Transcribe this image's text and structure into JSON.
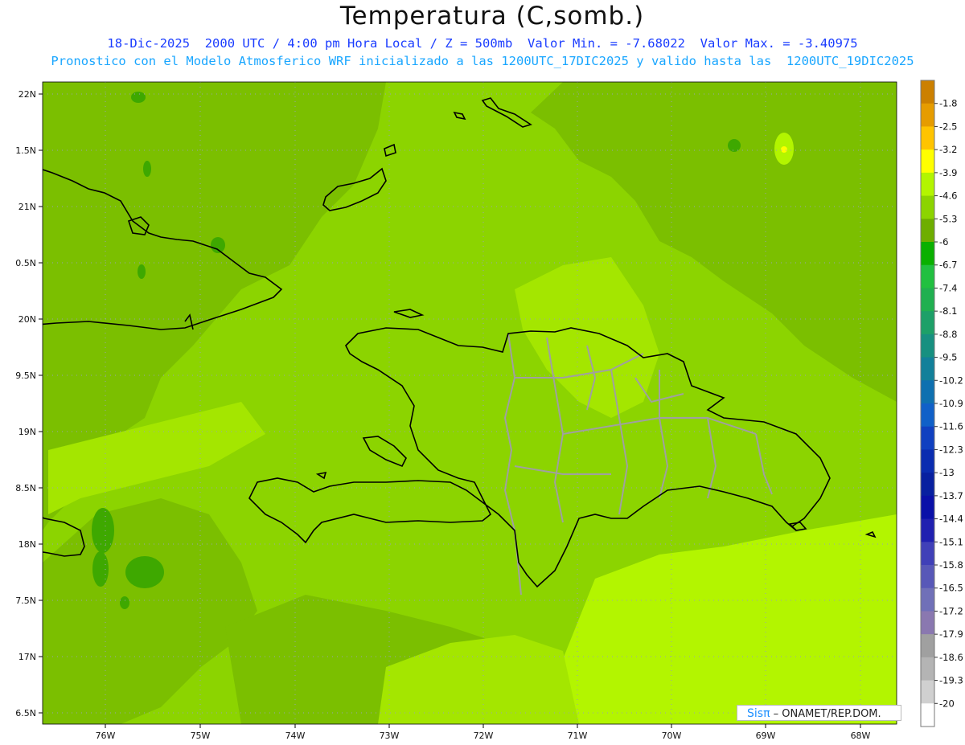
{
  "title": "Temperatura (C,somb.)",
  "subtitle_line1": "18-Dic-2025  2000 UTC / 4:00 pm Hora Local / Z = 500mb  Valor Min. = -7.68022  Valor Max. = -3.40975",
  "subtitle_line2": "Pronostico con el Modelo Atmosferico WRF inicializado a las 1200UTC_17DIC2025 y valido hasta las  1200UTC_19DIC2025",
  "map": {
    "lat_ticks": [
      "22N",
      "1.5N",
      "21N",
      "0.5N",
      "20N",
      "9.5N",
      "19N",
      "8.5N",
      "18N",
      "7.5N",
      "17N",
      "6.5N"
    ],
    "lon_ticks": [
      "76W",
      "75W",
      "74W",
      "73W",
      "72W",
      "71W",
      "70W",
      "69W",
      "68W"
    ],
    "background_color": "#8cd400",
    "colors": {
      "darker_green": "#7bbf00",
      "medium_green": "#8cd400",
      "light_green": "#a4e600",
      "lighter_green": "#b3f500",
      "dark_patch": "#3ea800",
      "yellow_spot": "#ffff00",
      "coastline": "#000000",
      "province_borders": "#a0a0a0",
      "grid": "#9aa0b0"
    }
  },
  "colorbar": {
    "labels": [
      "-1.8",
      "-2.5",
      "-3.2",
      "-3.9",
      "-4.6",
      "-5.3",
      "-6",
      "-6.7",
      "-7.4",
      "-8.1",
      "-8.8",
      "-9.5",
      "-10.2",
      "-10.9",
      "-11.6",
      "-12.3",
      "-13",
      "-13.7",
      "-14.4",
      "-15.1",
      "-15.8",
      "-16.5",
      "-17.2",
      "-17.9",
      "-18.6",
      "-19.3",
      "-20"
    ],
    "colors": [
      "#cc8000",
      "#e69c00",
      "#ffc400",
      "#ffff00",
      "#b3f500",
      "#8cd400",
      "#6eae00",
      "#0ab000",
      "#21c040",
      "#20b050",
      "#1da068",
      "#179080",
      "#12809a",
      "#0e70b0",
      "#1060c8",
      "#1040c0",
      "#0a2cb0",
      "#0820a0",
      "#0a10a8",
      "#2020b0",
      "#4040b8",
      "#5858b8",
      "#7070b8",
      "#8a78b0",
      "#a0a0a0",
      "#b4b4b4",
      "#d0d0d0",
      "#ffffff"
    ]
  },
  "watermark": {
    "logo": "Sisπ",
    "text": "– ONAMET/REP.DOM."
  }
}
